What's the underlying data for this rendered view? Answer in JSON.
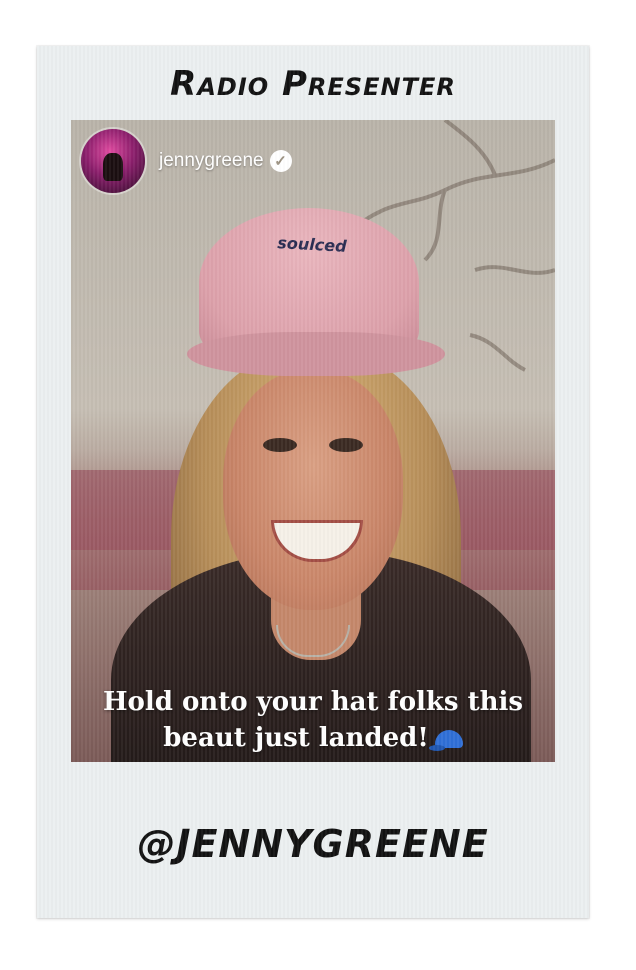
{
  "frame": {
    "top_caption": "Radio Presenter",
    "bottom_caption": "@jennygreene"
  },
  "post": {
    "username": "jennygreene",
    "verified_icon": "✓",
    "cap_logo_text": "soulced",
    "overlay_line1": "Hold onto your hat folks this",
    "overlay_line2": "beaut just landed!"
  },
  "colors": {
    "frame": "#ebeff0",
    "cap_pink": "#dca0aa",
    "emoji_cap_blue": "#2f6fd6"
  }
}
